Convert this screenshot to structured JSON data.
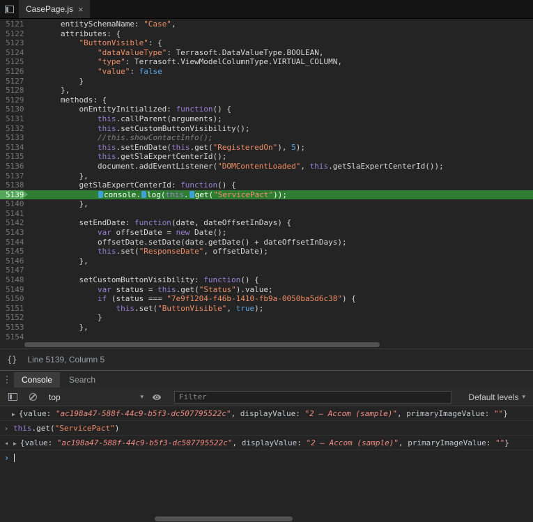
{
  "sources": {
    "tab": {
      "title": "CasePage.js",
      "close": "×"
    },
    "status": {
      "pretty_print": "{}",
      "position": "Line 5139, Column 5"
    },
    "editor": {
      "highlight_line": 5139,
      "lines": [
        {
          "n": 5121,
          "tokens": [
            [
              "        entitySchemaName: ",
              "d"
            ],
            [
              "\"Case\"",
              "s"
            ],
            [
              ",",
              "d"
            ]
          ]
        },
        {
          "n": 5122,
          "tokens": [
            [
              "        attributes: {",
              "d"
            ]
          ]
        },
        {
          "n": 5123,
          "tokens": [
            [
              "            ",
              "d"
            ],
            [
              "\"ButtonVisible\"",
              "s"
            ],
            [
              ": {",
              "d"
            ]
          ]
        },
        {
          "n": 5124,
          "tokens": [
            [
              "                ",
              "d"
            ],
            [
              "\"dataValueType\"",
              "s"
            ],
            [
              ": Terrasoft.DataValueType.BOOLEAN,",
              "d"
            ]
          ]
        },
        {
          "n": 5125,
          "tokens": [
            [
              "                ",
              "d"
            ],
            [
              "\"type\"",
              "s"
            ],
            [
              ": Terrasoft.ViewModelColumnType.VIRTUAL_COLUMN,",
              "d"
            ]
          ]
        },
        {
          "n": 5126,
          "tokens": [
            [
              "                ",
              "d"
            ],
            [
              "\"value\"",
              "s"
            ],
            [
              ": ",
              "d"
            ],
            [
              "false",
              "n"
            ]
          ]
        },
        {
          "n": 5127,
          "tokens": [
            [
              "            }",
              "d"
            ]
          ]
        },
        {
          "n": 5128,
          "tokens": [
            [
              "        },",
              "d"
            ]
          ]
        },
        {
          "n": 5129,
          "tokens": [
            [
              "        methods: {",
              "d"
            ]
          ]
        },
        {
          "n": 5130,
          "tokens": [
            [
              "            onEntityInitialized: ",
              "d"
            ],
            [
              "function",
              "k"
            ],
            [
              "() {",
              "d"
            ]
          ]
        },
        {
          "n": 5131,
          "tokens": [
            [
              "                ",
              "d"
            ],
            [
              "this",
              "k"
            ],
            [
              ".callParent(arguments);",
              "d"
            ]
          ]
        },
        {
          "n": 5132,
          "tokens": [
            [
              "                ",
              "d"
            ],
            [
              "this",
              "k"
            ],
            [
              ".setCustomButtonVisibility();",
              "d"
            ]
          ]
        },
        {
          "n": 5133,
          "tokens": [
            [
              "                ",
              "d"
            ],
            [
              "//this.showContactInfo();",
              "c"
            ]
          ]
        },
        {
          "n": 5134,
          "tokens": [
            [
              "                ",
              "d"
            ],
            [
              "this",
              "k"
            ],
            [
              ".setEndDate(",
              "d"
            ],
            [
              "this",
              "k"
            ],
            [
              ".get(",
              "d"
            ],
            [
              "\"RegisteredOn\"",
              "s"
            ],
            [
              "), ",
              "d"
            ],
            [
              "5",
              "n"
            ],
            [
              ");",
              "d"
            ]
          ]
        },
        {
          "n": 5135,
          "tokens": [
            [
              "                ",
              "d"
            ],
            [
              "this",
              "k"
            ],
            [
              ".getSlaExpertCenterId();",
              "d"
            ]
          ]
        },
        {
          "n": 5136,
          "tokens": [
            [
              "                document.addEventListener(",
              "d"
            ],
            [
              "\"DOMContentLoaded\"",
              "s"
            ],
            [
              ", ",
              "d"
            ],
            [
              "this",
              "k"
            ],
            [
              ".getSlaExpertCenterId());",
              "d"
            ]
          ]
        },
        {
          "n": 5137,
          "tokens": [
            [
              "            },",
              "d"
            ]
          ]
        },
        {
          "n": 5138,
          "tokens": [
            [
              "            getSlaExpertCenterId: ",
              "d"
            ],
            [
              "function",
              "k"
            ],
            [
              "() {",
              "d"
            ]
          ]
        },
        {
          "n": 5139,
          "tokens": [
            [
              "                ",
              "d"
            ],
            [
              "",
              "chip"
            ],
            [
              "console.",
              "d"
            ],
            [
              "",
              "chip"
            ],
            [
              "log(",
              "d"
            ],
            [
              "this",
              "k"
            ],
            [
              ".",
              "d"
            ],
            [
              "",
              "chip"
            ],
            [
              "get(",
              "d"
            ],
            [
              "\"ServicePact\"",
              "s"
            ],
            [
              "));",
              "d"
            ]
          ]
        },
        {
          "n": 5140,
          "tokens": [
            [
              "            },",
              "d"
            ]
          ]
        },
        {
          "n": 5141,
          "tokens": []
        },
        {
          "n": 5142,
          "tokens": [
            [
              "            setEndDate: ",
              "d"
            ],
            [
              "function",
              "k"
            ],
            [
              "(date, dateOffsetInDays) {",
              "d"
            ]
          ]
        },
        {
          "n": 5143,
          "tokens": [
            [
              "                ",
              "d"
            ],
            [
              "var",
              "k"
            ],
            [
              " offsetDate = ",
              "d"
            ],
            [
              "new",
              "k"
            ],
            [
              " Date();",
              "d"
            ]
          ]
        },
        {
          "n": 5144,
          "tokens": [
            [
              "                offsetDate.setDate(date.getDate() + dateOffsetInDays);",
              "d"
            ]
          ]
        },
        {
          "n": 5145,
          "tokens": [
            [
              "                ",
              "d"
            ],
            [
              "this",
              "k"
            ],
            [
              ".set(",
              "d"
            ],
            [
              "\"ResponseDate\"",
              "s"
            ],
            [
              ", offsetDate);",
              "d"
            ]
          ]
        },
        {
          "n": 5146,
          "tokens": [
            [
              "            },",
              "d"
            ]
          ]
        },
        {
          "n": 5147,
          "tokens": []
        },
        {
          "n": 5148,
          "tokens": [
            [
              "            setCustomButtonVisibility: ",
              "d"
            ],
            [
              "function",
              "k"
            ],
            [
              "() {",
              "d"
            ]
          ]
        },
        {
          "n": 5149,
          "tokens": [
            [
              "                ",
              "d"
            ],
            [
              "var",
              "k"
            ],
            [
              " status = ",
              "d"
            ],
            [
              "this",
              "k"
            ],
            [
              ".get(",
              "d"
            ],
            [
              "\"Status\"",
              "s"
            ],
            [
              ").value;",
              "d"
            ]
          ]
        },
        {
          "n": 5150,
          "tokens": [
            [
              "                ",
              "d"
            ],
            [
              "if",
              "k"
            ],
            [
              " (status === ",
              "d"
            ],
            [
              "\"7e9f1204-f46b-1410-fb9a-0050ba5d6c38\"",
              "s"
            ],
            [
              ") {",
              "d"
            ]
          ]
        },
        {
          "n": 5151,
          "tokens": [
            [
              "                    ",
              "d"
            ],
            [
              "this",
              "k"
            ],
            [
              ".set(",
              "d"
            ],
            [
              "\"ButtonVisible\"",
              "s"
            ],
            [
              ", ",
              "d"
            ],
            [
              "true",
              "n"
            ],
            [
              ");",
              "d"
            ]
          ]
        },
        {
          "n": 5152,
          "tokens": [
            [
              "                }",
              "d"
            ]
          ]
        },
        {
          "n": 5153,
          "tokens": [
            [
              "            },",
              "d"
            ]
          ]
        },
        {
          "n": 5154,
          "tokens": []
        }
      ]
    }
  },
  "drawer": {
    "kebab": "⋮",
    "tabs": [
      {
        "label": "Console",
        "active": true
      },
      {
        "label": "Search",
        "active": false
      }
    ],
    "toolbar": {
      "context": "top",
      "caret": "▾",
      "filter_placeholder": "Filter",
      "levels": "Default levels"
    },
    "messages": [
      {
        "type": "log",
        "expander": "▶",
        "tokens": [
          [
            "{",
            "d"
          ],
          [
            "value",
            "key"
          ],
          [
            ": ",
            "d"
          ],
          [
            "\"ac198a47-588f-44c9-b5f3-dc507795522c\"",
            "si"
          ],
          [
            ", ",
            "d"
          ],
          [
            "displayValue",
            "key"
          ],
          [
            ": ",
            "d"
          ],
          [
            "\"2 — Accom (sample)\"",
            "si"
          ],
          [
            ", ",
            "d"
          ],
          [
            "primaryImageValue",
            "key"
          ],
          [
            ": ",
            "d"
          ],
          [
            "\"\"",
            "si"
          ],
          [
            "}",
            "d"
          ]
        ]
      },
      {
        "type": "command",
        "arrow": "›",
        "tokens": [
          [
            "this",
            "k"
          ],
          [
            ".get(",
            "d"
          ],
          [
            "\"ServicePact\"",
            "s"
          ],
          [
            ")",
            "d"
          ]
        ]
      },
      {
        "type": "result",
        "arrow": "◂",
        "expander": "▶",
        "tokens": [
          [
            "{",
            "d"
          ],
          [
            "value",
            "key"
          ],
          [
            ": ",
            "d"
          ],
          [
            "\"ac198a47-588f-44c9-b5f3-dc507795522c\"",
            "si"
          ],
          [
            ", ",
            "d"
          ],
          [
            "displayValue",
            "key"
          ],
          [
            ": ",
            "d"
          ],
          [
            "\"2 — Accom (sample)\"",
            "si"
          ],
          [
            ", ",
            "d"
          ],
          [
            "primaryImageValue",
            "key"
          ],
          [
            ": ",
            "d"
          ],
          [
            "\"\"",
            "si"
          ],
          [
            "}",
            "d"
          ]
        ]
      },
      {
        "type": "prompt",
        "arrow": "›",
        "cursor": true,
        "tokens": []
      }
    ]
  },
  "colors": {
    "exec_line_green": "#2e7d32",
    "keyword_purple": "#9a7fd5",
    "string_orange": "#f08c65",
    "number_blue": "#5ca7e8",
    "background": "#242424"
  }
}
